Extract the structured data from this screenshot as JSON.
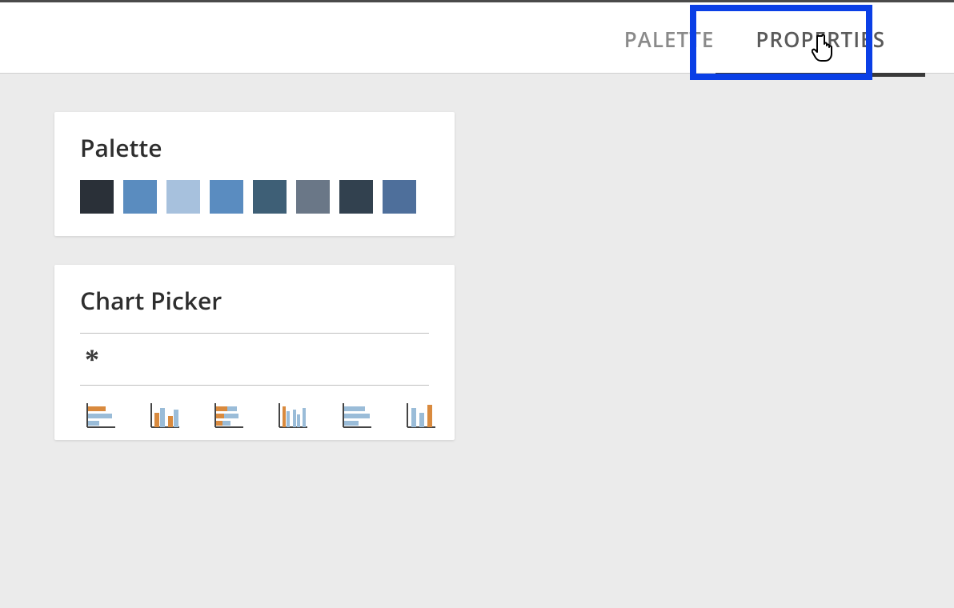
{
  "tabs": {
    "palette": "PALETTE",
    "properties": "PROPERTIES"
  },
  "palette_card": {
    "title": "Palette",
    "swatches": [
      {
        "name": "swatch-dark-slate",
        "color": "#2a3038"
      },
      {
        "name": "swatch-steel-blue",
        "color": "#5a8cbf"
      },
      {
        "name": "swatch-light-blue",
        "color": "#a7c1dd"
      },
      {
        "name": "swatch-medium-blue",
        "color": "#5a8cc0"
      },
      {
        "name": "swatch-slate-blue",
        "color": "#3e5f76"
      },
      {
        "name": "swatch-gray-blue",
        "color": "#6a7787"
      },
      {
        "name": "swatch-charcoal",
        "color": "#32414f"
      },
      {
        "name": "swatch-denim",
        "color": "#4e6f9b"
      }
    ]
  },
  "chart_picker_card": {
    "title": "Chart Picker",
    "all_symbol": "*",
    "charts": [
      {
        "name": "chart-icon-horizontal-bar"
      },
      {
        "name": "chart-icon-grouped-vertical-bar"
      },
      {
        "name": "chart-icon-stacked-horizontal-bar"
      },
      {
        "name": "chart-icon-grouped-vertical-bar-alt"
      },
      {
        "name": "chart-icon-horizontal-bar-alt"
      },
      {
        "name": "chart-icon-vertical-bar"
      }
    ]
  },
  "colors": {
    "highlight": "#0a3fe6",
    "accent_orange": "#d98a3e",
    "accent_blue": "#9abcd8",
    "axis": "#444444"
  }
}
